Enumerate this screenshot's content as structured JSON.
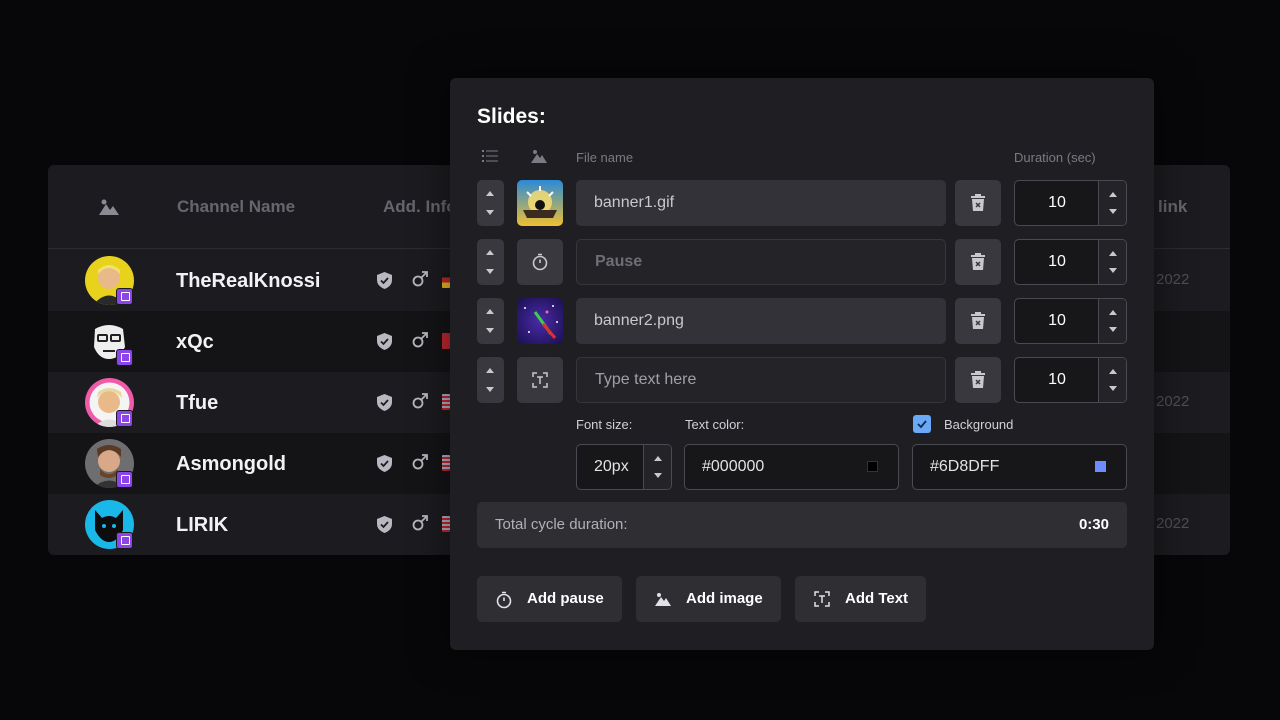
{
  "background_table": {
    "headers": {
      "channel_name": "Channel Name",
      "add_info": "Add. Info",
      "link": "link"
    },
    "rows": [
      {
        "name": "TheRealKnossi",
        "date": "2022",
        "flag_color": "#d8a020"
      },
      {
        "name": "xQc",
        "date": "",
        "flag_color": "#c0282e"
      },
      {
        "name": "Tfue",
        "date": "2022",
        "flag_color": "#7d7fb0"
      },
      {
        "name": "Asmongold",
        "date": "",
        "flag_color": "#7d7fb0"
      },
      {
        "name": "LIRIK",
        "date": "2022",
        "flag_color": "#7d7fb0"
      }
    ]
  },
  "slides": {
    "title": "Slides:",
    "columns": {
      "file_name": "File name",
      "duration": "Duration (sec)"
    },
    "items": [
      {
        "type": "image",
        "value": "banner1.gif",
        "duration": "10"
      },
      {
        "type": "pause",
        "value": "Pause",
        "duration": "10"
      },
      {
        "type": "image",
        "value": "banner2.png",
        "duration": "10"
      },
      {
        "type": "text",
        "value": "",
        "placeholder": "Type text here",
        "duration": "10"
      }
    ],
    "text_options": {
      "font_size_label": "Font size:",
      "font_size": "20px",
      "text_color_label": "Text color:",
      "text_color": "#000000",
      "background_label": "Background",
      "background_checked": true,
      "background_color": "#6D8DFF"
    },
    "total": {
      "label": "Total cycle duration:",
      "value": "0:30"
    },
    "buttons": {
      "add_pause": "Add pause",
      "add_image": "Add image",
      "add_text": "Add Text"
    }
  },
  "colors": {
    "accent_checkbox": "#6aa9f5",
    "twitch": "#8b45e8"
  }
}
